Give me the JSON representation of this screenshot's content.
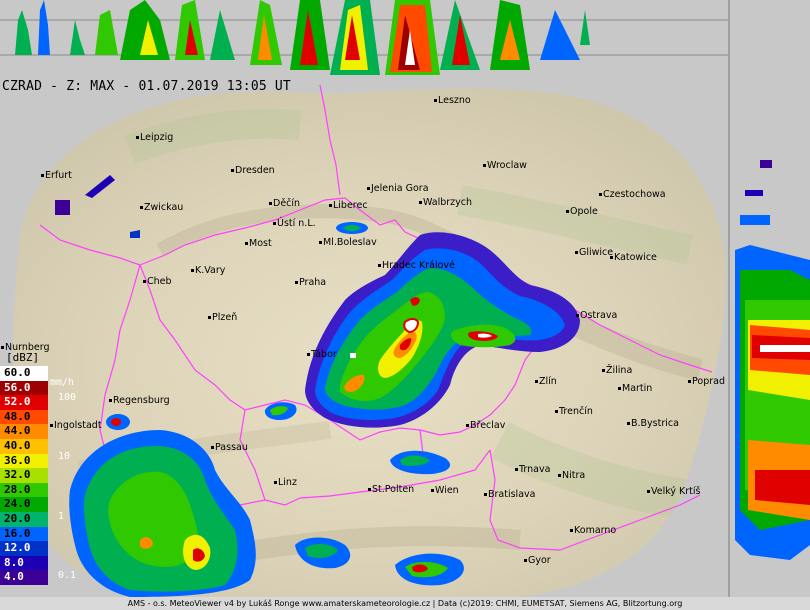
{
  "title": "CZRAD - Z: MAX - 01.07.2019 13:05 UT",
  "footer": "AMS - o.s. MeteoViewer v4 by Lukáš Ronge www.amaterskameteorologie.cz | Data (c)2019: CHMI, EUMETSAT, Siemens AG, Blitzortung.org",
  "legend": {
    "unit": "[dBZ]",
    "rate_unit": "mm/h",
    "rate_labels": [
      "100",
      "10",
      "1",
      "0.1"
    ],
    "levels": [
      {
        "label": "60.0",
        "color": "#ffffff",
        "text": "#000000"
      },
      {
        "label": "56.0",
        "color": "#9c0000",
        "text": "#ffffff"
      },
      {
        "label": "52.0",
        "color": "#e00000",
        "text": "#ffffff"
      },
      {
        "label": "48.0",
        "color": "#ff4a00",
        "text": "#000000"
      },
      {
        "label": "44.0",
        "color": "#ff8c00",
        "text": "#000000"
      },
      {
        "label": "40.0",
        "color": "#ffc000",
        "text": "#000000"
      },
      {
        "label": "36.0",
        "color": "#f0f000",
        "text": "#000000"
      },
      {
        "label": "32.0",
        "color": "#a8e000",
        "text": "#000000"
      },
      {
        "label": "28.0",
        "color": "#30c800",
        "text": "#000000"
      },
      {
        "label": "24.0",
        "color": "#00a800",
        "text": "#000000"
      },
      {
        "label": "20.0",
        "color": "#00b46e",
        "text": "#000000"
      },
      {
        "label": "16.0",
        "color": "#0064ff",
        "text": "#000000"
      },
      {
        "label": "12.0",
        "color": "#0032c8",
        "text": "#ffffff"
      },
      {
        "label": "8.0",
        "color": "#1e00b4",
        "text": "#ffffff"
      },
      {
        "label": "4.0",
        "color": "#3c0096",
        "text": "#ffffff"
      }
    ]
  },
  "colors": {
    "background": "#c8c8c8",
    "map_land": "#e4dcc4",
    "border_line": "#ff40ff",
    "echo_weak": "#3c1ec8",
    "echo_light": "#0064ff",
    "echo_moderate": "#00b050",
    "echo_heavy": "#c8e000",
    "echo_intense": "#e00000"
  },
  "cities": [
    {
      "name": "Leszno"
    },
    {
      "name": "Leipzig"
    },
    {
      "name": "Wroclaw"
    },
    {
      "name": "Erfurt"
    },
    {
      "name": "Dresden"
    },
    {
      "name": "Jelenia Gora"
    },
    {
      "name": "Czestochowa"
    },
    {
      "name": "Zwickau"
    },
    {
      "name": "Děčín"
    },
    {
      "name": "Liberec"
    },
    {
      "name": "Walbrzych"
    },
    {
      "name": "Opole"
    },
    {
      "name": "Ústí n.L."
    },
    {
      "name": "Most"
    },
    {
      "name": "Ml.Boleslav"
    },
    {
      "name": "Gliwice"
    },
    {
      "name": "Katowice"
    },
    {
      "name": "K.Vary"
    },
    {
      "name": "Hradec Králové"
    },
    {
      "name": "Cheb"
    },
    {
      "name": "Praha"
    },
    {
      "name": "Ostrava"
    },
    {
      "name": "Plzeň"
    },
    {
      "name": "Nurnberg"
    },
    {
      "name": "Tábor"
    },
    {
      "name": "Žilina"
    },
    {
      "name": "Zlín"
    },
    {
      "name": "Poprad"
    },
    {
      "name": "Martin"
    },
    {
      "name": "Regensburg"
    },
    {
      "name": "Trenčín"
    },
    {
      "name": "Ingolstadt"
    },
    {
      "name": "Břeclav"
    },
    {
      "name": "B.Bystrica"
    },
    {
      "name": "Passau"
    },
    {
      "name": "Trnava"
    },
    {
      "name": "Nitra"
    },
    {
      "name": "Linz"
    },
    {
      "name": "St.Polten"
    },
    {
      "name": "Wien"
    },
    {
      "name": "Bratislava"
    },
    {
      "name": "Velký Krtíš"
    },
    {
      "name": "Komarno"
    },
    {
      "name": "Gyor"
    }
  ]
}
